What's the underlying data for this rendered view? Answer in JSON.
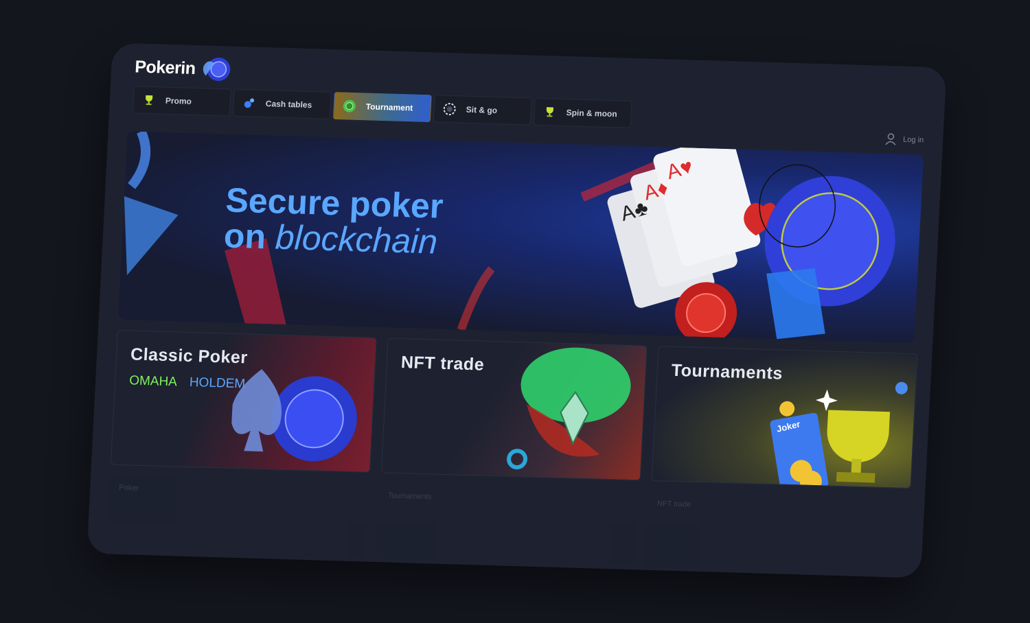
{
  "app": {
    "name": "Pokerin"
  },
  "nav": {
    "tabs": [
      {
        "label": "Promo",
        "icon": "trophy-icon",
        "active": false
      },
      {
        "label": "Cash tables",
        "icon": "chips-icon",
        "active": false
      },
      {
        "label": "Tournament",
        "icon": "chip-green-icon",
        "active": true
      },
      {
        "label": "Sit & go",
        "icon": "chip-ring-icon",
        "active": false
      },
      {
        "label": "Spin & moon",
        "icon": "trophy-icon",
        "active": false
      }
    ]
  },
  "header": {
    "login_label": "Log in"
  },
  "hero": {
    "line1": "Secure poker",
    "line2_prefix": "on",
    "line2_italic": "blockchain"
  },
  "cards": [
    {
      "title": "Classic Poker",
      "sub": [
        "OMAHA",
        "HOLDEM"
      ]
    },
    {
      "title": "NFT trade"
    },
    {
      "title": "Tournaments",
      "badge": "Joker"
    }
  ],
  "shelf": [
    {
      "label": "Poker"
    },
    {
      "label": "Tournaments"
    },
    {
      "label": "NFT trade"
    }
  ],
  "colors": {
    "accent_blue": "#5aa7ff",
    "accent_green": "#7df25a",
    "panel": "#1e2230",
    "background": "#14161e"
  }
}
